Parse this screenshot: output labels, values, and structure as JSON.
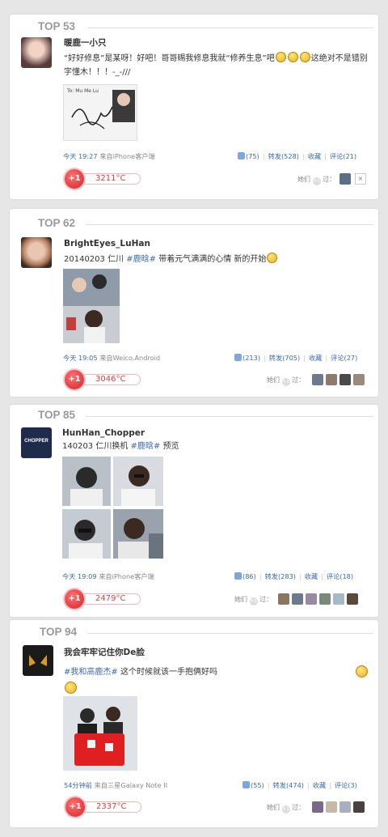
{
  "posts": [
    {
      "rank": "TOP 53",
      "user": "暖鹿一小只",
      "text_a": "“好好修息”是某呀！好吧！哥哥赐我修息我就“修养生息”吧",
      "text_b": "这绝对不是错别字懂木！！！-_-///",
      "time": "今天 19:27",
      "source": "来自iPhone客户端",
      "likes": "(75)",
      "repost": "转发(528)",
      "fav": "收藏",
      "comment": "评论(21)",
      "plus": "+1",
      "temp": "3211°C",
      "passed": "她们",
      "passed2": "过："
    },
    {
      "rank": "TOP 62",
      "user": "BrightEyes_LuHan",
      "text_a": "20140203 仁川 ",
      "tag": "#鹿晗#",
      "text_b": " 带着元气满满的心情 新的开始",
      "time": "今天 19:05",
      "source": "来自Weico.Android",
      "likes": "(213)",
      "repost": "转发(705)",
      "fav": "收藏",
      "comment": "评论(27)",
      "plus": "+1",
      "temp": "3046°C",
      "passed": "她们",
      "passed2": "过："
    },
    {
      "rank": "TOP 85",
      "user": "HunHan_Chopper",
      "avatar_text": "CHOPPER",
      "text_a": "140203 仁川换机 ",
      "tag": "#鹿晗#",
      "text_b": " 预览",
      "time": "今天 19:09",
      "source": "来自iPhone客户端",
      "likes": "(86)",
      "repost": "转发(283)",
      "fav": "收藏",
      "comment": "评论(18)",
      "plus": "+1",
      "temp": "2479°C",
      "passed": "她们",
      "passed2": "过："
    },
    {
      "rank": "TOP 94",
      "user": "我会牢牢记住你De脸",
      "tag": "#我和高鹿杰#",
      "text_b": " 这个时候就该一手抱俩好吗",
      "time": "54分钟前",
      "source": "来自三星Galaxy Note II",
      "likes": "(55)",
      "repost": "转发(474)",
      "fav": "收藏",
      "comment": "评论(3)",
      "plus": "+1",
      "temp": "2337°C",
      "passed": "她们",
      "passed2": "过："
    }
  ],
  "signature_text": "To: Mu Me Lu",
  "close_glyph": "×",
  "colors": {
    "link": "#3b6ab5",
    "heat": "#d8232a",
    "rank": "#9a9a9a"
  }
}
